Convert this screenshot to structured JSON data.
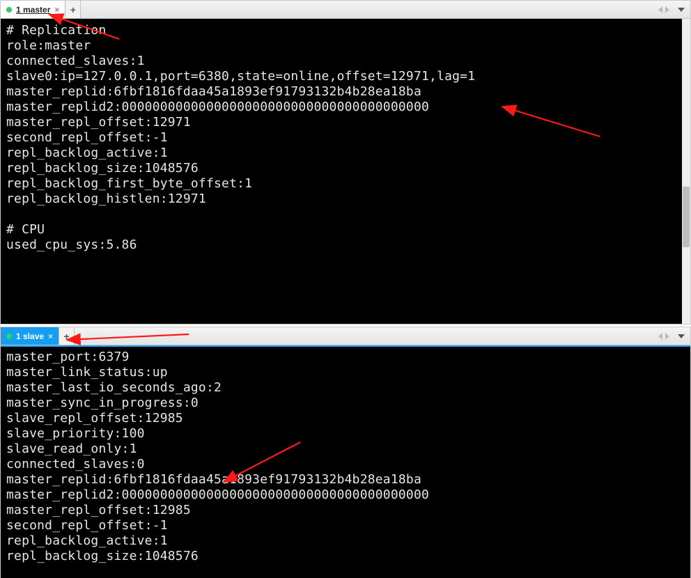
{
  "panes": {
    "master": {
      "tab_label": "1 master",
      "lines": [
        "# Replication",
        "role:master",
        "connected_slaves:1",
        "slave0:ip=127.0.0.1,port=6380,state=online,offset=12971,lag=1",
        "master_replid:6fbf1816fdaa45a1893ef91793132b4b28ea18ba",
        "master_replid2:0000000000000000000000000000000000000000",
        "master_repl_offset:12971",
        "second_repl_offset:-1",
        "repl_backlog_active:1",
        "repl_backlog_size:1048576",
        "repl_backlog_first_byte_offset:1",
        "repl_backlog_histlen:12971",
        "",
        "# CPU",
        "used_cpu_sys:5.86"
      ]
    },
    "slave": {
      "tab_label": "1 slave",
      "lines": [
        "master_port:6379",
        "master_link_status:up",
        "master_last_io_seconds_ago:2",
        "master_sync_in_progress:0",
        "slave_repl_offset:12985",
        "slave_priority:100",
        "slave_read_only:1",
        "connected_slaves:0",
        "master_replid:6fbf1816fdaa45a1893ef91793132b4b28ea18ba",
        "master_replid2:0000000000000000000000000000000000000000",
        "master_repl_offset:12985",
        "second_repl_offset:-1",
        "repl_backlog_active:1",
        "repl_backlog_size:1048576"
      ]
    }
  },
  "tabbar": {
    "add_tab_label": "+"
  }
}
